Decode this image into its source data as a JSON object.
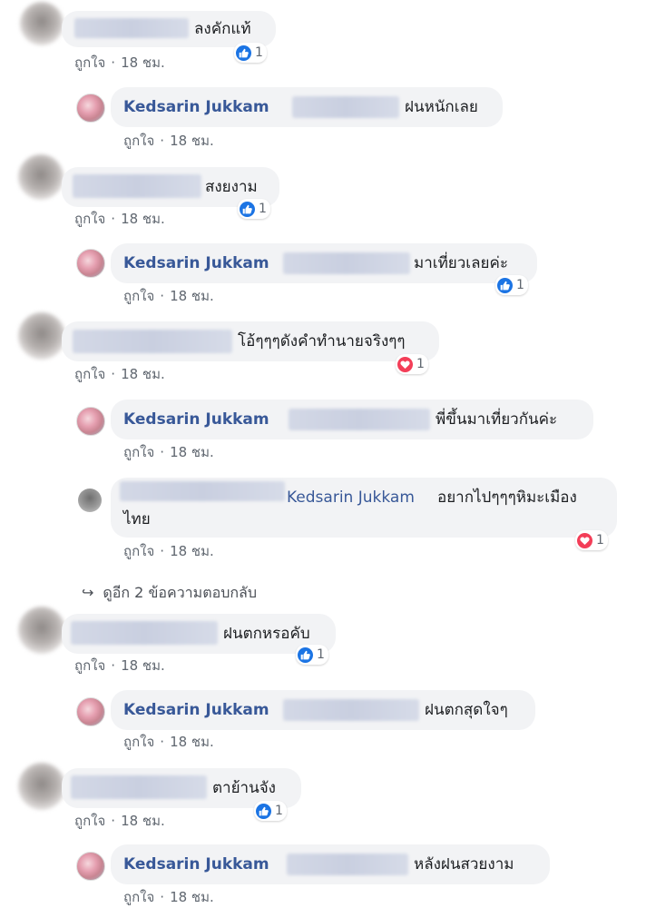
{
  "labels": {
    "like": "ถูกใจ",
    "time": "18 ชม."
  },
  "comments": [
    {
      "text": "ลงคักแท้",
      "reaction": "like",
      "count": "1"
    },
    {
      "author": "Kedsarin Jukkam",
      "text": "ฝนหนักเลย"
    },
    {
      "text": "สงยงาม",
      "reaction": "like",
      "count": "1"
    },
    {
      "author": "Kedsarin Jukkam",
      "text": "มาเที่ยวเลยค่ะ",
      "reaction": "like",
      "count": "1"
    },
    {
      "text": "โอ้ๆๆๆดังคำทำนายจริงๆๆ",
      "reaction": "love",
      "count": "1"
    },
    {
      "author": "Kedsarin Jukkam",
      "text": "พี่ขึ้นมาเที่ยวกันค่ะ"
    },
    {
      "mention": "Kedsarin Jukkam",
      "text_line1": "อยากไปๆๆๆหิมะเมือง",
      "text_line2": "ไทย",
      "reaction": "love",
      "count": "1"
    },
    {
      "text": "ฝนตกหรอคับ",
      "reaction": "like",
      "count": "1"
    },
    {
      "author": "Kedsarin Jukkam",
      "text": "ฝนตกสุดใจๆ"
    },
    {
      "text": "ตาย้านจัง",
      "reaction": "like",
      "count": "1"
    },
    {
      "author": "Kedsarin Jukkam",
      "text": "หลังฝนสวยงาม"
    }
  ],
  "view_more_replies": "ดูอีก 2 ข้อความตอบกลับ",
  "colors": {
    "bubble": "#f2f3f5",
    "name": "#385898",
    "like": "#1b74e4",
    "love": "#f33e58",
    "meta": "#606770"
  }
}
